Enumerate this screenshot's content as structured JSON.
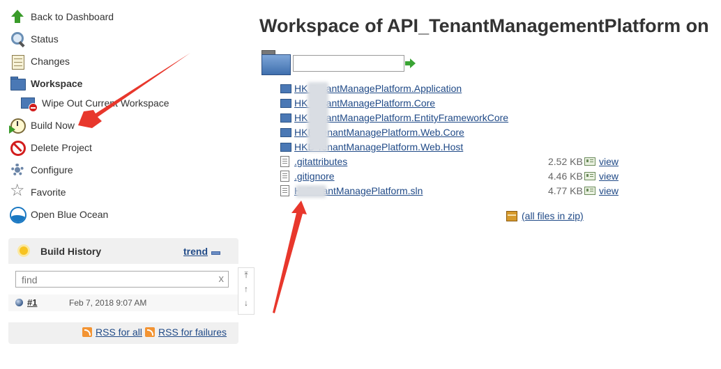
{
  "sidebar": {
    "items": [
      {
        "label": "Back to Dashboard",
        "icon": "arrow-up-icon"
      },
      {
        "label": "Status",
        "icon": "magnifier-icon"
      },
      {
        "label": "Changes",
        "icon": "notepad-icon"
      },
      {
        "label": "Workspace",
        "icon": "folder-icon"
      },
      {
        "label": "Wipe Out Current Workspace",
        "icon": "wipe-folder-icon"
      },
      {
        "label": "Build Now",
        "icon": "clock-icon"
      },
      {
        "label": "Delete Project",
        "icon": "no-entry-icon"
      },
      {
        "label": "Configure",
        "icon": "gear-icon"
      },
      {
        "label": "Favorite",
        "icon": "star-icon"
      },
      {
        "label": "Open Blue Ocean",
        "icon": "blue-ocean-icon"
      }
    ]
  },
  "build_history": {
    "title": "Build History",
    "trend_label": "trend",
    "search_placeholder": "find",
    "clear_label": "x",
    "builds": [
      {
        "number": "#1",
        "date": "Feb 7, 2018 9:07 AM",
        "status_color": "#3c5d8c"
      }
    ],
    "rss_all": "RSS for all",
    "rss_failures": "RSS for failures",
    "nav": [
      "⤒",
      "↑",
      "↓"
    ]
  },
  "main": {
    "title": "Workspace of API_TenantManagementPlatform on",
    "path_value": "",
    "folders": [
      {
        "name": "HK   TenantManagePlatform.Application"
      },
      {
        "name": "HK   TenantManagePlatform.Core"
      },
      {
        "name": "HK   TenantManagePlatform.EntityFrameworkCore"
      },
      {
        "name": "HKB  TenantManagePlatform.Web.Core"
      },
      {
        "name": "HKB  TenantManagePlatform.Web.Host"
      }
    ],
    "files": [
      {
        "name": ".gitattributes",
        "size": "2.52 KB",
        "view": "view"
      },
      {
        "name": ".gitignore",
        "size": "4.46 KB",
        "view": "view"
      },
      {
        "name": "H      .TenantManagePlatform.sln",
        "size": "4.77 KB",
        "view": "view"
      }
    ],
    "zip_label": "(all files in zip)"
  },
  "colors": {
    "link": "#204a87",
    "annotation": "#e8372c",
    "folder": "#4a78b5"
  }
}
